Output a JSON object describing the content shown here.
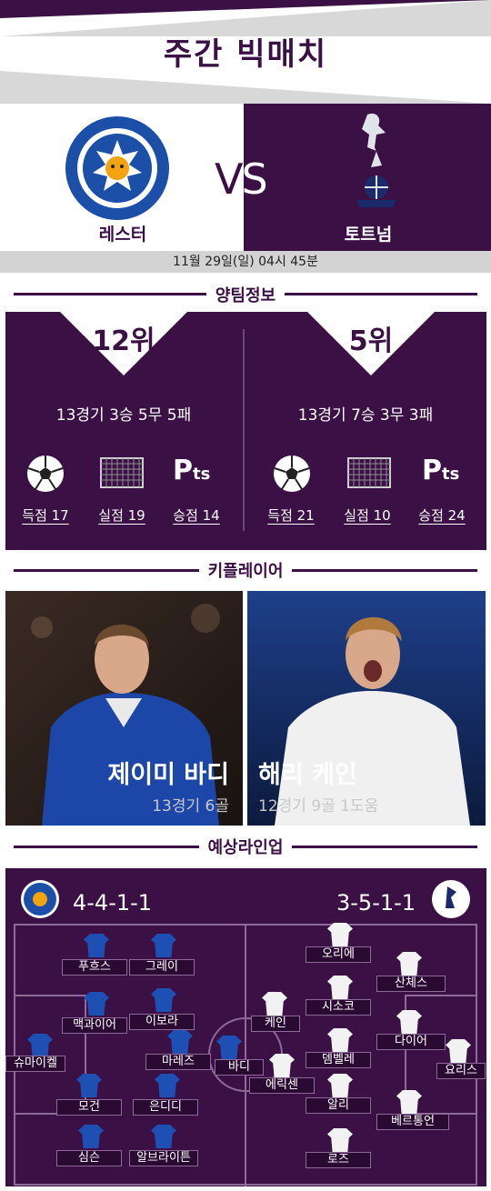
{
  "title": "주간 빅매치",
  "match": {
    "vs": "VS",
    "home": "레스터",
    "away": "토트넘",
    "date": "11월 29일(일) 04시 45분"
  },
  "sections": {
    "teams": "양팀정보",
    "key_players": "키플레이어",
    "lineup": "예상라인업"
  },
  "home_info": {
    "rank": "12위",
    "record": "13경기 3승 5무 5패",
    "goals": "득점 17",
    "conceded": "실점 19",
    "points": "승점 14"
  },
  "away_info": {
    "rank": "5위",
    "record": "13경기 7승 3무 3패",
    "goals": "득점 21",
    "conceded": "실점 10",
    "points": "승점 24"
  },
  "pts_icon": {
    "big": "P",
    "small": "ts"
  },
  "key_players": {
    "home": {
      "name": "제이미 바디",
      "stats": "13경기 6골"
    },
    "away": {
      "name": "해리 케인",
      "stats": "12경기 9골 1도움"
    }
  },
  "lineup": {
    "home_formation": "4-4-1-1",
    "away_formation": "3-5-1-1",
    "home_players": [
      "푸흐스",
      "그레이",
      "맥과이어",
      "이보라",
      "슈마이켈",
      "마레즈",
      "바디",
      "모건",
      "은디디",
      "심슨",
      "알브라이튼"
    ],
    "away_players": [
      "오리에",
      "산체스",
      "시소코",
      "케인",
      "요리스",
      "뎀벨레",
      "다이어",
      "에릭센",
      "알리",
      "베르통언",
      "로즈"
    ]
  },
  "icons": {
    "ball": "soccer-ball-icon",
    "goal": "goal-net-icon",
    "points": "points-icon"
  },
  "colors": {
    "primary": "#3a1045",
    "home_kit": "#1e4fb3",
    "away_kit": "#f2f2f2"
  }
}
